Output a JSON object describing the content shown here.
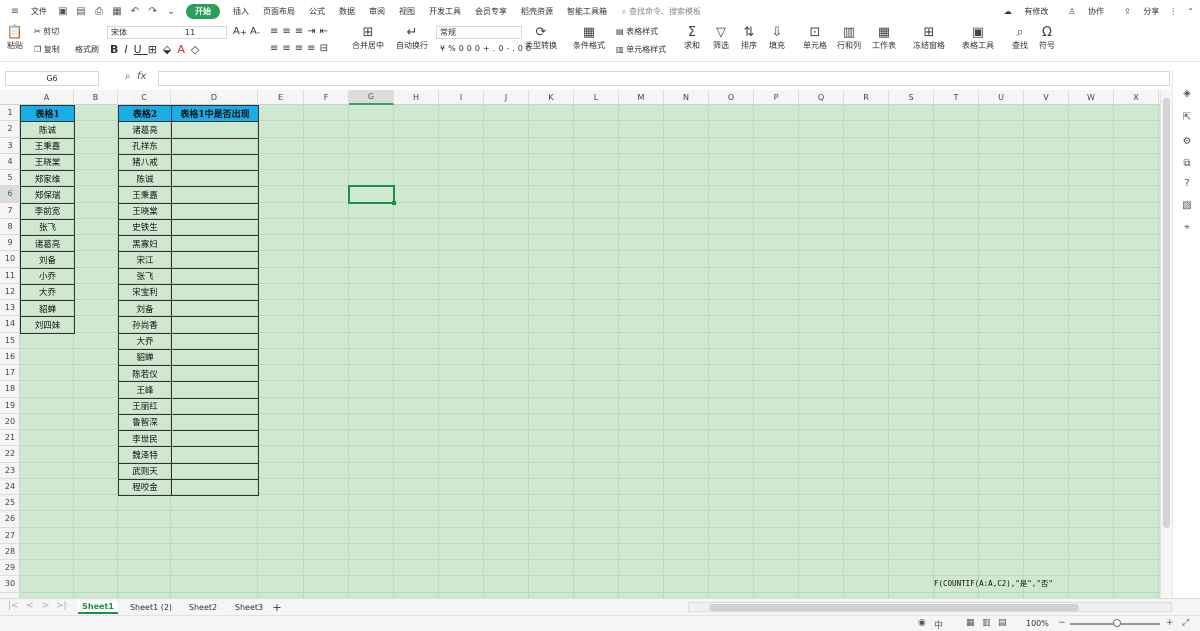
{
  "menubar": {
    "file": "文件",
    "start": "开始",
    "tabs": [
      "插入",
      "页面布局",
      "公式",
      "数据",
      "审阅",
      "视图",
      "开发工具",
      "会员专享",
      "稻壳资源",
      "智能工具箱"
    ],
    "search": "查找命令、搜索模板",
    "right": {
      "changes": "有修改",
      "collab": "协作",
      "share": "分享"
    }
  },
  "ribbon": {
    "paste": "粘贴",
    "cut": "剪切",
    "copy": "复制",
    "format_painter": "格式刷",
    "font_name": "宋体",
    "font_size": "11",
    "merge": "合并居中",
    "wrap": "自动换行",
    "number_format": "常规",
    "convert": "类型转换",
    "cond_format": "条件格式",
    "table_style": "表格样式",
    "cell_style": "单元格样式",
    "sum": "求和",
    "filter": "筛选",
    "sort": "排序",
    "fill": "填充",
    "cells": "单元格",
    "rowcol": "行和列",
    "sheet": "工作表",
    "freeze": "冻结窗格",
    "table_tools": "表格工具",
    "find": "查找",
    "symbol": "符号",
    "currency": "¥",
    "percent": "%",
    "thousands": "000",
    "dec_inc": "+.0",
    "dec_dec": "-.00"
  },
  "formula_bar": {
    "name_box": "G6",
    "fx": "fx",
    "value": ""
  },
  "columns": [
    "A",
    "B",
    "C",
    "D",
    "E",
    "F",
    "G",
    "H",
    "I",
    "J",
    "K",
    "L",
    "M",
    "N",
    "O",
    "P",
    "Q",
    "R",
    "S",
    "T",
    "U",
    "V",
    "W",
    "X"
  ],
  "selected_column": "G",
  "rows": [
    "1",
    "2",
    "3",
    "4",
    "5",
    "6",
    "7",
    "8",
    "9",
    "10",
    "11",
    "12",
    "13",
    "14",
    "15",
    "16",
    "17",
    "18",
    "19",
    "20",
    "21",
    "22",
    "23",
    "24",
    "25",
    "26",
    "27",
    "28",
    "29",
    "30"
  ],
  "selected_row": "6",
  "table1": {
    "header": "表格1",
    "values": [
      "陈诚",
      "王秉嘉",
      "王晓棠",
      "郑家维",
      "郑保瑞",
      "李前宽",
      "张飞",
      "诸葛亮",
      "刘备",
      "小乔",
      "大乔",
      "貂蝉",
      "刘四妹"
    ]
  },
  "table2": {
    "header_c": "表格2",
    "header_d": "表格1中是否出现",
    "values": [
      "诸葛亮",
      "孔祥东",
      "猪八戒",
      "陈诚",
      "王秉嘉",
      "王晓棠",
      "史铁生",
      "黑寡妇",
      "宋江",
      "张飞",
      "宋宝利",
      "刘备",
      "孙尚香",
      "大乔",
      "貂蝉",
      "陈若仪",
      "王峰",
      "王丽红",
      "鲁智深",
      "李世民",
      "魏泽特",
      "武则天",
      "程咬金"
    ]
  },
  "formula_note": "F(COUNTIF(A:A,C2),\"是\",\"否\"",
  "sheets": [
    "Sheet1",
    "Sheet1 (2)",
    "Sheet2",
    "Sheet3"
  ],
  "active_sheet": "Sheet1",
  "status": {
    "zoom": "100%"
  }
}
